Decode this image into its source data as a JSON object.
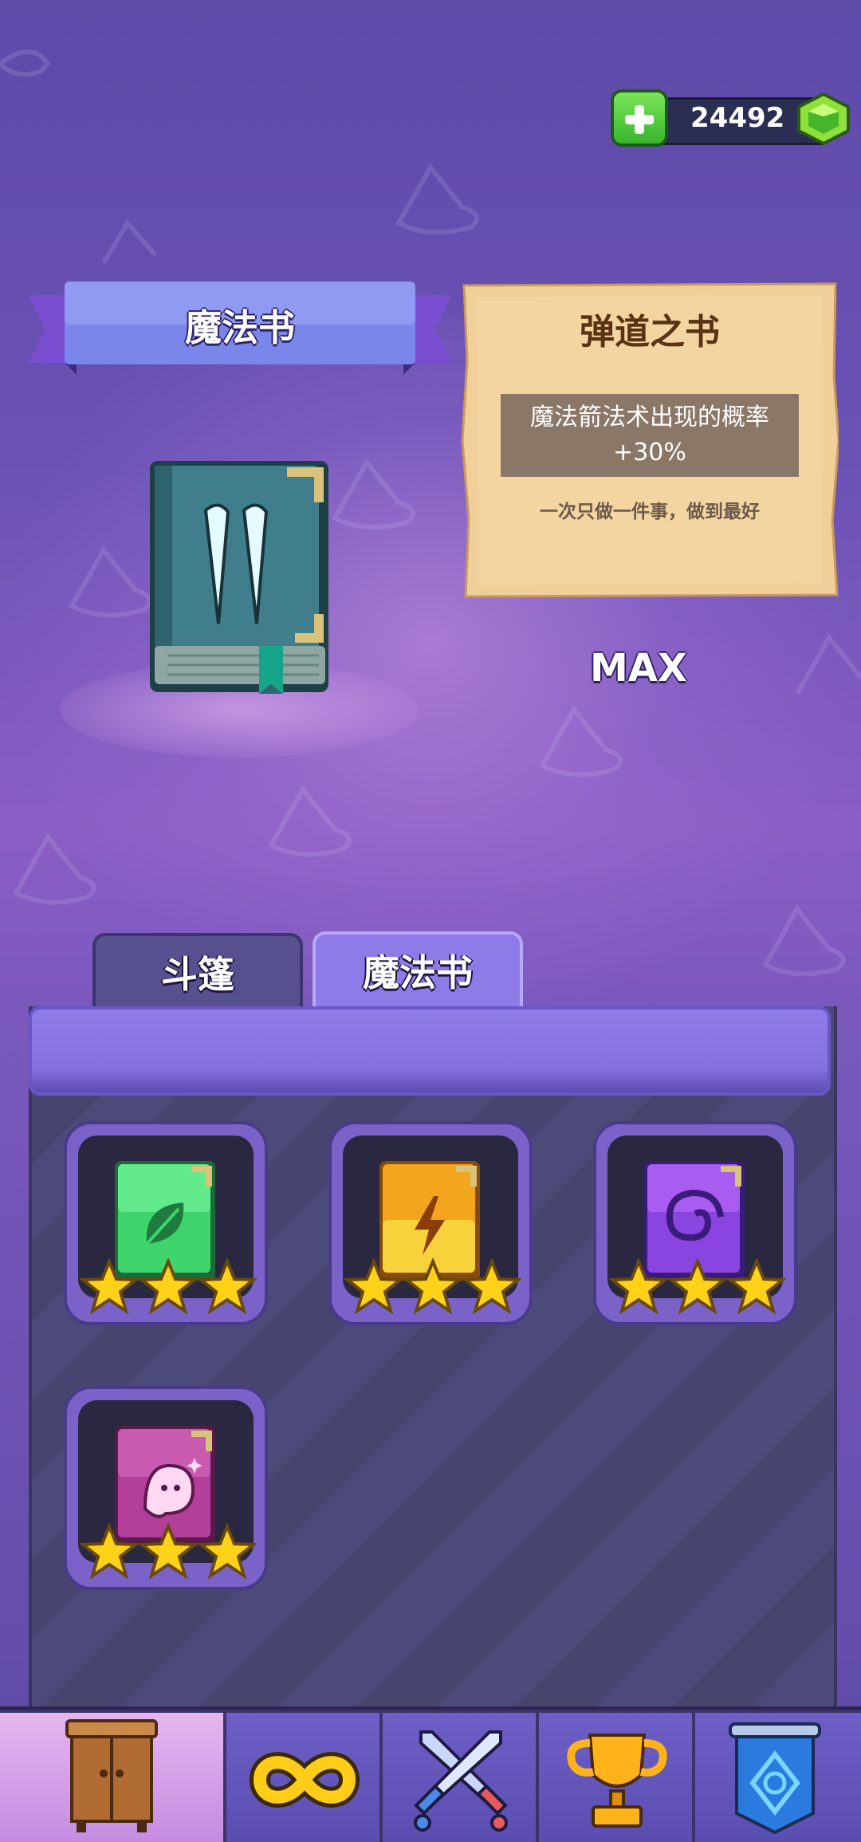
{
  "currency": {
    "amount": "24492",
    "add_icon": "plus-icon",
    "gem_icon": "green-gem-icon"
  },
  "banner": {
    "title": "魔法书"
  },
  "selected_book": {
    "icon": "icicle-spellbook-icon",
    "name": "弹道之书",
    "effect_line1": "魔法箭法术出现的概率",
    "effect_line2": "+30%",
    "quote": "一次只做一件事，做到最好",
    "level": "MAX"
  },
  "tabs": [
    {
      "label": "斗篷",
      "active": false
    },
    {
      "label": "魔法书",
      "active": true
    }
  ],
  "books": [
    {
      "icon": "leaf-spellbook-icon",
      "color": "#3fcf6a",
      "stars": 3
    },
    {
      "icon": "lightning-spellbook-icon",
      "color": "#f4a21e",
      "stars": 3
    },
    {
      "icon": "swirl-spellbook-icon",
      "color": "#8a44e0",
      "stars": 3
    },
    {
      "icon": "ghost-spellbook-icon",
      "color": "#b23f9a",
      "stars": 3
    }
  ],
  "nav": [
    {
      "icon": "wardrobe-icon",
      "active": true
    },
    {
      "icon": "infinity-icon",
      "active": false
    },
    {
      "icon": "crossed-swords-icon",
      "active": false
    },
    {
      "icon": "trophy-icon",
      "active": false
    },
    {
      "icon": "banner-icon",
      "active": false
    }
  ]
}
